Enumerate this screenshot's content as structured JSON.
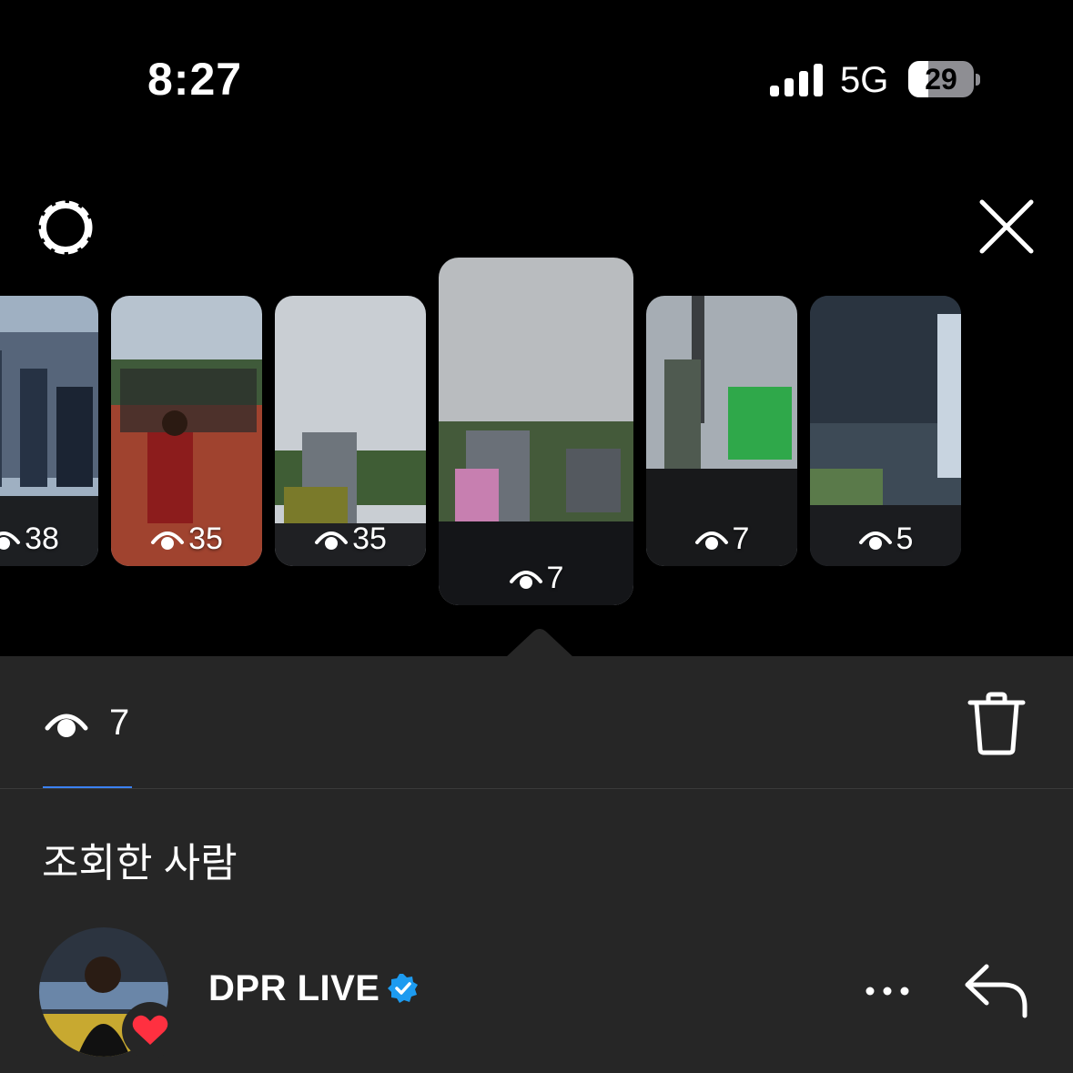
{
  "status_bar": {
    "time": "8:27",
    "network": "5G",
    "battery": "29"
  },
  "stories": [
    {
      "views": "38"
    },
    {
      "views": "35"
    },
    {
      "views": "35"
    },
    {
      "views": "7",
      "selected": true
    },
    {
      "views": "7"
    },
    {
      "views": "5"
    }
  ],
  "selected_story": {
    "views": "7"
  },
  "viewers_section": {
    "title": "조회한 사람"
  },
  "viewers": [
    {
      "name": "DPR LIVE",
      "verified": true,
      "liked": true
    }
  ],
  "colors": {
    "accent": "#3b82f6",
    "verified": "#1d9bf0",
    "heart": "#ff3040",
    "sheet": "#262626"
  },
  "icons": [
    "settings-icon",
    "close-icon",
    "eye-icon",
    "trash-icon",
    "verified-badge-icon",
    "heart-icon",
    "more-icon",
    "reply-icon"
  ]
}
